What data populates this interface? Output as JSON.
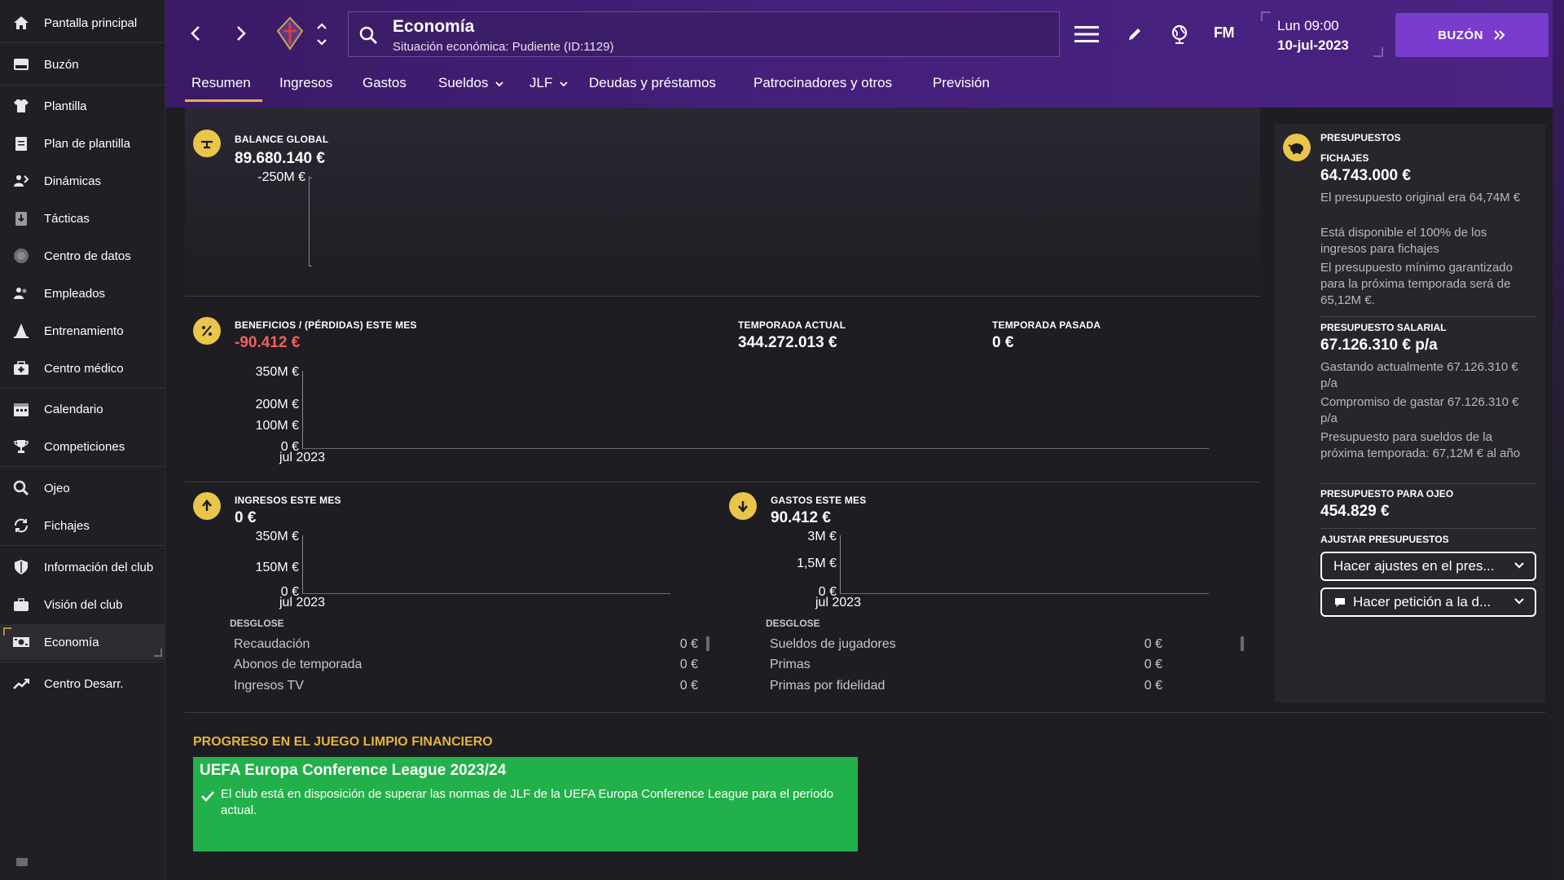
{
  "sidebar": {
    "items": [
      {
        "label": "Pantalla principal",
        "icon": "home-icon"
      },
      {
        "label": "Buzón",
        "icon": "inbox-icon"
      },
      {
        "label": "Plantilla",
        "icon": "shirt-icon"
      },
      {
        "label": "Plan de plantilla",
        "icon": "clipboard-icon"
      },
      {
        "label": "Dinámicas",
        "icon": "dynamics-icon"
      },
      {
        "label": "Tácticas",
        "icon": "tactics-board-icon"
      },
      {
        "label": "Centro de datos",
        "icon": "data-hub-icon"
      },
      {
        "label": "Empleados",
        "icon": "staff-icon"
      },
      {
        "label": "Entrenamiento",
        "icon": "training-cone-icon"
      },
      {
        "label": "Centro médico",
        "icon": "medical-kit-icon"
      },
      {
        "label": "Calendario",
        "icon": "calendar-icon"
      },
      {
        "label": "Competiciones",
        "icon": "trophy-icon"
      },
      {
        "label": "Ojeo",
        "icon": "magnifier-icon"
      },
      {
        "label": "Fichajes",
        "icon": "transfer-arrows-icon"
      },
      {
        "label": "Información del club",
        "icon": "shield-icon"
      },
      {
        "label": "Visión del club",
        "icon": "briefcase-icon"
      },
      {
        "label": "Economía",
        "icon": "money-icon"
      },
      {
        "label": "Centro Desarr.",
        "icon": "development-chart-icon"
      }
    ],
    "active_index": 16
  },
  "header": {
    "title": "Economía",
    "subtitle": "Situación económica: Pudiente (ID:1129)",
    "fm_logo": "FM",
    "day_time": "Lun 09:00",
    "date": "10-jul-2023",
    "inbox_button": "BUZÓN"
  },
  "tabs": [
    {
      "label": "Resumen",
      "active": true
    },
    {
      "label": "Ingresos"
    },
    {
      "label": "Gastos"
    },
    {
      "label": "Sueldos",
      "dropdown": true
    },
    {
      "label": "JLF",
      "dropdown": true
    },
    {
      "label": "Deudas y préstamos"
    },
    {
      "label": "Patrocinadores y otros"
    },
    {
      "label": "Previsión"
    }
  ],
  "balance": {
    "label": "BALANCE GLOBAL",
    "value": "89.680.140 €",
    "axis_top": "-250M €"
  },
  "profit": {
    "label": "BENEFICIOS / (PÉRDIDAS) ESTE MES",
    "value": "-90.412 €",
    "current_season_label": "TEMPORADA ACTUAL",
    "current_season_value": "344.272.013 €",
    "last_season_label": "TEMPORADA PASADA",
    "last_season_value": "0 €",
    "axis": [
      "350M €",
      "200M €",
      "100M €",
      "0 €"
    ],
    "x_label": "jul 2023"
  },
  "income": {
    "label": "INGRESOS ESTE MES",
    "value": "0 €",
    "axis": [
      "350M €",
      "150M €",
      "0 €"
    ],
    "x_label": "jul 2023",
    "breakdown_title": "DESGLOSE",
    "rows": [
      {
        "name": "Recaudación",
        "value": "0 €"
      },
      {
        "name": "Abonos de temporada",
        "value": "0 €"
      },
      {
        "name": "Ingresos TV",
        "value": "0 €"
      }
    ]
  },
  "expenses": {
    "label": "GASTOS ESTE MES",
    "value": "90.412 €",
    "axis": [
      "3M €",
      "1,5M €",
      "0 €"
    ],
    "x_label": "jul 2023",
    "breakdown_title": "DESGLOSE",
    "rows": [
      {
        "name": "Sueldos de jugadores",
        "value": "0 €"
      },
      {
        "name": "Primas",
        "value": "0 €"
      },
      {
        "name": "Primas por fidelidad",
        "value": "0 €"
      }
    ]
  },
  "budgets": {
    "title": "PRESUPUESTOS",
    "transfer_label": "FICHAJES",
    "transfer_value": "64.743.000 €",
    "transfer_notes": [
      "El presupuesto original era 64,74M €",
      "Está disponible el 100% de los ingresos para fichajes",
      "El presupuesto mínimo garantizado para la próxima temporada será de 65,12M €."
    ],
    "wage_label": "PRESUPUESTO SALARIAL",
    "wage_value": "67.126.310 € p/a",
    "wage_notes": [
      "Gastando actualmente 67.126.310 € p/a",
      "Compromiso de gastar 67.126.310 € p/a",
      "Presupuesto para sueldos de la próxima temporada: 67,12M € al año"
    ],
    "scout_label": "PRESUPUESTO PARA OJEO",
    "scout_value": "454.829 €",
    "adjust_label": "AJUSTAR PRESUPUESTOS",
    "adjust_button": "Hacer ajustes en el pres...",
    "request_button": "Hacer petición a la d..."
  },
  "ffp": {
    "title": "PROGRESO EN EL JUEGO LIMPIO FINANCIERO",
    "competition": "UEFA Europa Conference League 2023/24",
    "text": "El club está en disposición de superar las normas de JLF de la UEFA Europa Conference League para el periodo actual."
  },
  "colors": {
    "header_purple": "#44207a",
    "accent_gold": "#e6b43a",
    "inbox_purple": "#7a3ccc",
    "loss_red": "#f06060",
    "ffp_green": "#22b04a"
  }
}
